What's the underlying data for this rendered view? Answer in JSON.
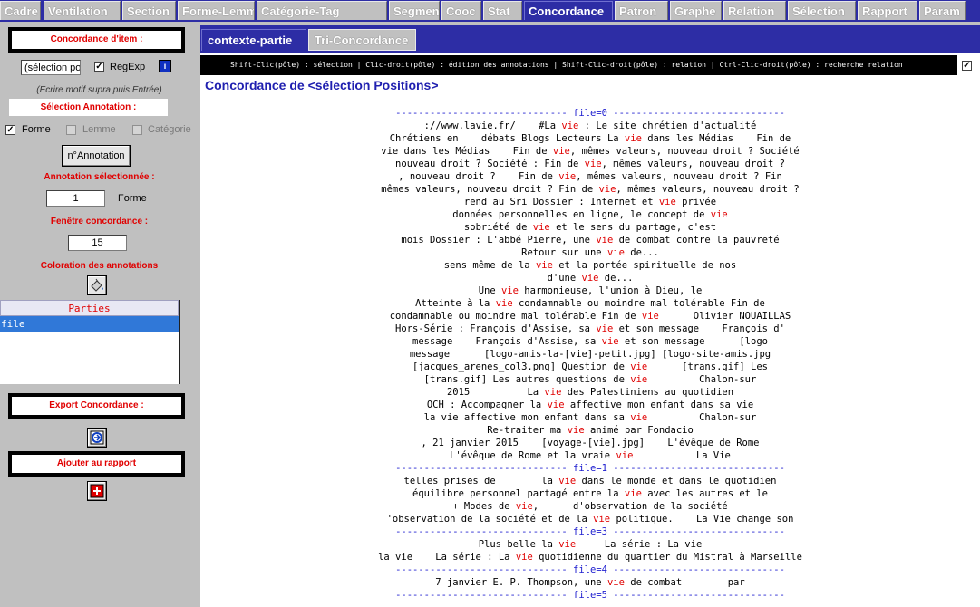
{
  "menu": {
    "tabs": [
      "Cadre",
      "Ventilation",
      "Section",
      "Forme-Lemme",
      "Catégorie-Tag",
      "Segment",
      "Cooc",
      "Stat",
      "Concordance",
      "Patron",
      "Graphe",
      "Relation",
      "Sélection",
      "Rapport",
      "Param"
    ],
    "active": "Concordance"
  },
  "left": {
    "item_header": "Concordance d'item :",
    "pattern_value": "(sélection po",
    "regexp_label": "RegExp",
    "hint": "(Ecrire motif supra puis Entrée)",
    "annotation_header": "Sélection Annotation :",
    "forme_label": "Forme",
    "lemme_label": "Lemme",
    "categorie_label": "Catégorie",
    "annotation_button": "n°Annotation",
    "selected_annotation_label": "Annotation sélectionnée :",
    "selected_annotation_value": "1",
    "selected_annotation_type": "Forme",
    "window_label": "Fenêtre concordance :",
    "window_value": "15",
    "coloring_label": "Coloration des annotations",
    "parties_header": "Parties",
    "parties_items": [
      "file"
    ],
    "export_header": "Export Concordance :",
    "add_report_header": "Ajouter au rapport"
  },
  "right": {
    "subtabs": [
      "contexte-partie",
      "Tri-Concordance"
    ],
    "instructions": "Shift-Clic(pôle) : sélection | Clic-droit(pôle) : édition des annotations | Shift-Clic-droit(pôle) : relation | Ctrl-Clic-droit(pôle) : recherche relation",
    "title": "Concordance de <sélection Positions>",
    "lines": [
      {
        "t": "------------------------------ file=0 ------------------------------",
        "sep": true
      },
      {
        "t": "://www.lavie.fr/    #La [vie] : Le site chrétien d'actualité"
      },
      {
        "t": "Chrétiens en    débats Blogs Lecteurs La [vie] dans les Médias    Fin de"
      },
      {
        "t": "vie dans les Médias    Fin de [vie], mêmes valeurs, nouveau droit ? Société"
      },
      {
        "t": "nouveau droit ? Société : Fin de [vie], mêmes valeurs, nouveau droit ?"
      },
      {
        "t": ", nouveau droit ?    Fin de [vie], mêmes valeurs, nouveau droit ? Fin"
      },
      {
        "t": "mêmes valeurs, nouveau droit ? Fin de [vie], mêmes valeurs, nouveau droit ?"
      },
      {
        "t": "rend au Sri Dossier : Internet et [vie] privée"
      },
      {
        "t": "données personnelles en ligne, le concept de [vie]"
      },
      {
        "t": "sobriété de [vie] et le sens du partage, c'est"
      },
      {
        "t": "mois Dossier : L'abbé Pierre, une [vie] de combat contre la pauvreté"
      },
      {
        "t": "Retour sur une [vie] de..."
      },
      {
        "t": "sens même de la [vie] et la portée spirituelle de nos"
      },
      {
        "t": "d'une [vie] de..."
      },
      {
        "t": "Une [vie] harmonieuse, l'union à Dieu, le"
      },
      {
        "t": "Atteinte à la [vie] condamnable ou moindre mal tolérable Fin de"
      },
      {
        "t": "condamnable ou moindre mal tolérable Fin de [vie]      Olivier NOUAILLAS"
      },
      {
        "t": "Hors-Série : François d'Assise, sa [vie] et son message    François d'"
      },
      {
        "t": "message    François d'Assise, sa [vie] et son message      [logo"
      },
      {
        "t": "message      [logo-amis-la-[vie]-petit.jpg] [logo-site-amis.jpg"
      },
      {
        "t": "[jacques_arenes_col3.png] Question de [vie]      [trans.gif] Les"
      },
      {
        "t": "[trans.gif] Les autres questions de [vie]         Chalon-sur"
      },
      {
        "t": "2015          La [vie] des Palestiniens au quotidien"
      },
      {
        "t": "OCH : Accompagner la [vie] affective mon enfant dans sa vie"
      },
      {
        "t": "la vie affective mon enfant dans sa [vie]         Chalon-sur"
      },
      {
        "t": "Re-traiter ma [vie] animé par Fondacio"
      },
      {
        "t": ", 21 janvier 2015    [voyage-[vie].jpg]    L'évêque de Rome"
      },
      {
        "t": "L'évêque de Rome et la vraie [vie]           La Vie"
      },
      {
        "t": "------------------------------ file=1 ------------------------------",
        "sep": true
      },
      {
        "t": "telles prises de        la [vie] dans le monde et dans le quotidien"
      },
      {
        "t": "équilibre personnel partagé entre la [vie] avec les autres et le"
      },
      {
        "t": "+ Modes de [vie],      d'observation de la société"
      },
      {
        "t": "'observation de la société et de la [vie] politique.    La Vie change son"
      },
      {
        "t": "------------------------------ file=3 ------------------------------",
        "sep": true
      },
      {
        "t": "Plus belle la [vie]     La série : La vie"
      },
      {
        "t": "la vie    La série : La [vie] quotidienne du quartier du Mistral à Marseille"
      },
      {
        "t": "------------------------------ file=4 ------------------------------",
        "sep": true
      },
      {
        "t": "7 janvier E. P. Thompson, une [vie] de combat        par"
      },
      {
        "t": "------------------------------ file=5 ------------------------------",
        "sep": true
      }
    ]
  },
  "colors": {
    "menu_bg": "#2d2da5",
    "panel_bg": "#c0c0c0",
    "label_red": "#e00000",
    "title_blue": "#2020b0",
    "keyword_red": "#e00000",
    "selection_blue": "#3078d8"
  }
}
